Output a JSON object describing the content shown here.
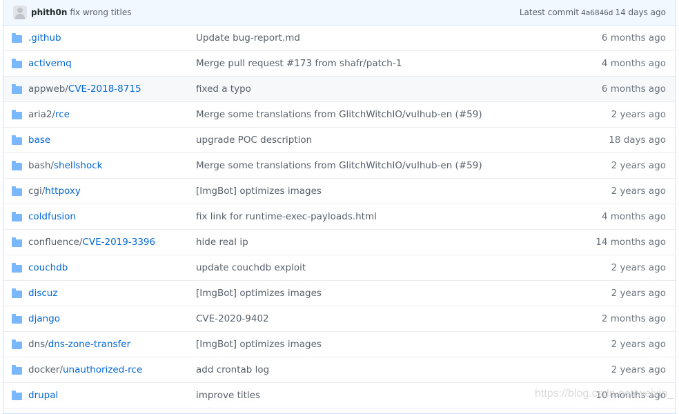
{
  "commit_bar": {
    "author": "phith0n",
    "message": "fix wrong titles",
    "latest_label": "Latest commit",
    "sha": "4a6846d",
    "age": "14 days ago"
  },
  "rows": [
    {
      "prefix": "",
      "link": ".github",
      "message": "Update bug-report.md",
      "age": "6 months ago"
    },
    {
      "prefix": "",
      "link": "activemq",
      "message": "Merge pull request #173 from shafr/patch-1",
      "age": "4 months ago"
    },
    {
      "prefix": "appweb/",
      "link": "CVE-2018-8715",
      "message": "fixed a typo",
      "age": "6 months ago"
    },
    {
      "prefix": "aria2/",
      "link": "rce",
      "message": "Merge some translations from GlitchWitchIO/vulhub-en (#59)",
      "age": "2 years ago"
    },
    {
      "prefix": "",
      "link": "base",
      "message": "upgrade POC description",
      "age": "18 days ago"
    },
    {
      "prefix": "bash/",
      "link": "shellshock",
      "message": "Merge some translations from GlitchWitchIO/vulhub-en (#59)",
      "age": "2 years ago"
    },
    {
      "prefix": "cgi/",
      "link": "httpoxy",
      "message": "[ImgBot] optimizes images",
      "age": "2 years ago"
    },
    {
      "prefix": "",
      "link": "coldfusion",
      "message": "fix link for runtime-exec-payloads.html",
      "age": "4 months ago"
    },
    {
      "prefix": "confluence/",
      "link": "CVE-2019-3396",
      "message": "hide real ip",
      "age": "14 months ago"
    },
    {
      "prefix": "",
      "link": "couchdb",
      "message": "update couchdb exploit",
      "age": "2 years ago"
    },
    {
      "prefix": "",
      "link": "discuz",
      "message": "[ImgBot] optimizes images",
      "age": "2 years ago"
    },
    {
      "prefix": "",
      "link": "django",
      "message": "CVE-2020-9402",
      "age": "2 months ago"
    },
    {
      "prefix": "dns/",
      "link": "dns-zone-transfer",
      "message": "[ImgBot] optimizes images",
      "age": "2 years ago"
    },
    {
      "prefix": "docker/",
      "link": "unauthorized-rce",
      "message": "add crontab log",
      "age": "2 years ago"
    },
    {
      "prefix": "",
      "link": "drupal",
      "message": "improve titles",
      "age": "10 months ago"
    }
  ],
  "watermark": "https://blog.csdn.net/weixin_",
  "icons": {
    "folder": "folder-icon",
    "avatar": "avatar-icon"
  },
  "colors": {
    "link": "#0366d6",
    "folder": "#79b8ff",
    "commit_bar_bg": "#f1f8ff"
  }
}
